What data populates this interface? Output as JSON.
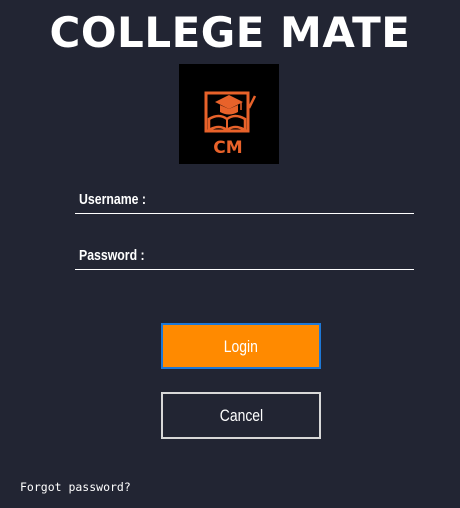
{
  "app": {
    "title": "COLLEGE MATE",
    "logo_text": "CM",
    "logo_icon": "graduation-book-icon"
  },
  "form": {
    "username_label": "Username :",
    "username_value": "",
    "password_label": "Password :",
    "password_value": ""
  },
  "buttons": {
    "login_label": "Login",
    "cancel_label": "Cancel"
  },
  "links": {
    "forgot_password": "Forgot password?"
  },
  "colors": {
    "background": "#222533",
    "accent": "#ff8a00",
    "logo_orange": "#e8622a",
    "focus_border": "#1e78d6"
  }
}
